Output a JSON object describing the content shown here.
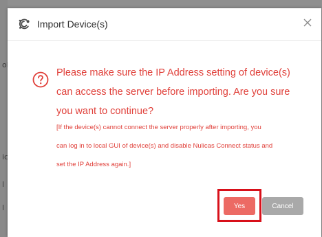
{
  "backdrop": {
    "glyphs": [
      "ol",
      "ic",
      "l",
      "l"
    ]
  },
  "dialog": {
    "title": "Import Device(s)",
    "title_icon": "cloud-gear-icon",
    "close_icon": "close-icon",
    "question_icon": "question-icon",
    "line1": "Please make sure the IP Address setting of device(s)",
    "line2": "can access the server before importing. Are you sure",
    "line3": "you want to continue?",
    "note1": "[If the device(s) cannot connect the server properly after importing, you",
    "note2": "can log in to local GUI of device(s) and disable Nulicas Connect status and",
    "note3": "set the IP Address again.]",
    "yes_label": "Yes",
    "cancel_label": "Cancel"
  },
  "colors": {
    "accent_red": "#e0403a",
    "yes_button": "#ec6a64",
    "cancel_button": "#a9a9a9",
    "highlight_box": "#d8101a"
  }
}
